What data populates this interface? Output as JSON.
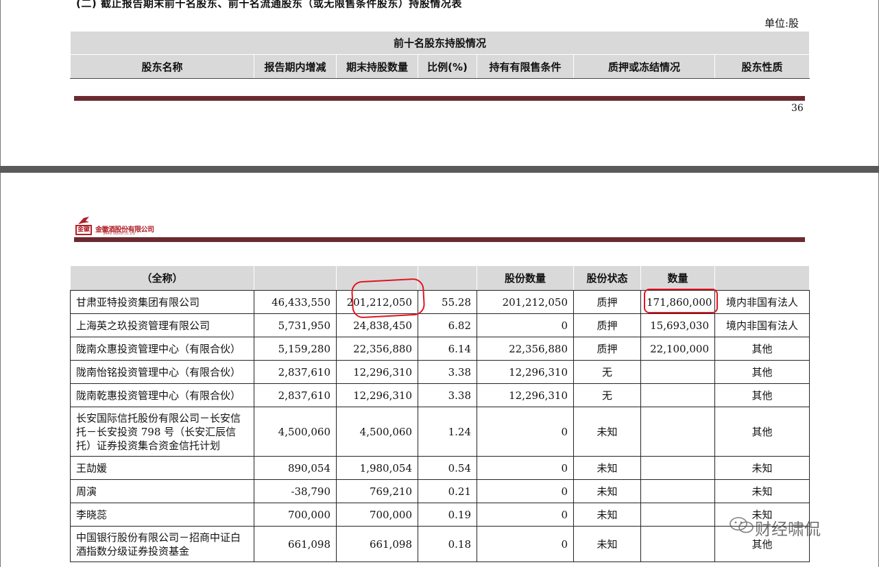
{
  "top_page": {
    "section_title": "(二)  截止报告期末前十名股东、前十名流通股东（或无限售条件股东）持股情况表",
    "unit": "单位:股",
    "table_title": "前十名股东持股情况",
    "headers": [
      "股东名称",
      "报告期内增减",
      "期末持股数量",
      "比例(%)",
      "持有有限售条件",
      "质押或冻结情况",
      "股东性质"
    ],
    "page_number": "36"
  },
  "logo": {
    "box_text": "金徽",
    "company_cn": "金徽酒股份有限公司",
    "company_en": "JINHUI LIQUOR CO.,LTD"
  },
  "main_table": {
    "headers": [
      "（全称）",
      "",
      "",
      "",
      "股份数量",
      "股份状态",
      "数量",
      ""
    ],
    "rows": [
      {
        "name": "甘肃亚特投资集团有限公司",
        "change": "46,433,550",
        "held": "201,212,050",
        "ratio": "55.28",
        "restricted": "201,212,050",
        "status": "质押",
        "qty": "171,860,000",
        "nature": "境内非国有法人"
      },
      {
        "name": "上海英之玖投资管理有限公司",
        "change": "5,731,950",
        "held": "24,838,450",
        "ratio": "6.82",
        "restricted": "0",
        "status": "质押",
        "qty": "15,693,030",
        "nature": "境内非国有法人"
      },
      {
        "name": "陇南众惠投资管理中心（有限合伙）",
        "change": "5,159,280",
        "held": "22,356,880",
        "ratio": "6.14",
        "restricted": "22,356,880",
        "status": "质押",
        "qty": "22,100,000",
        "nature": "其他"
      },
      {
        "name": "陇南怡铭投资管理中心（有限合伙）",
        "change": "2,837,610",
        "held": "12,296,310",
        "ratio": "3.38",
        "restricted": "12,296,310",
        "status": "无",
        "qty": "",
        "nature": "其他"
      },
      {
        "name": "陇南乾惠投资管理中心（有限合伙）",
        "change": "2,837,610",
        "held": "12,296,310",
        "ratio": "3.38",
        "restricted": "12,296,310",
        "status": "无",
        "qty": "",
        "nature": "其他"
      },
      {
        "name": "长安国际信托股份有限公司－长安信托－长安投资 798 号（长安汇辰信托）证券投资集合资金信托计划",
        "change": "4,500,060",
        "held": "4,500,060",
        "ratio": "1.24",
        "restricted": "0",
        "status": "未知",
        "qty": "",
        "nature": "其他"
      },
      {
        "name": "王劼媛",
        "change": "890,054",
        "held": "1,980,054",
        "ratio": "0.54",
        "restricted": "0",
        "status": "未知",
        "qty": "",
        "nature": "未知"
      },
      {
        "name": "周演",
        "change": "-38,790",
        "held": "769,210",
        "ratio": "0.21",
        "restricted": "0",
        "status": "未知",
        "qty": "",
        "nature": "未知"
      },
      {
        "name": "李晓蕊",
        "change": "700,000",
        "held": "700,000",
        "ratio": "0.19",
        "restricted": "0",
        "status": "未知",
        "qty": "",
        "nature": "未知"
      },
      {
        "name": "中国银行股份有限公司－招商中证白酒指数分级证券投资基金",
        "change": "661,098",
        "held": "661,098",
        "ratio": "0.18",
        "restricted": "0",
        "status": "未知",
        "qty": "",
        "nature": "其他"
      }
    ]
  },
  "watermark": "财经啸侃",
  "colors": {
    "rule": "#6b2a30",
    "header_bg": "#d9d9d9",
    "annotation": "#e0141e",
    "divider": "#5a5a5a"
  }
}
